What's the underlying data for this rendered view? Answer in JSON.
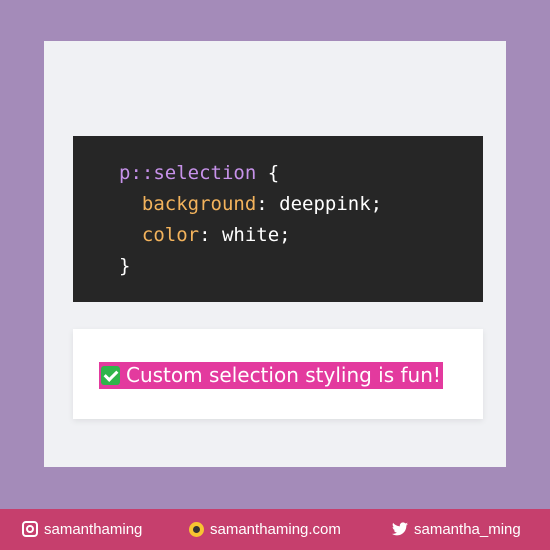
{
  "code": {
    "line1_selector": "p::selection",
    "line1_brace": " {",
    "line2_prop": "background",
    "line2_value": ": deeppink;",
    "line3_prop": "color",
    "line3_value": ": white;",
    "line4_brace": "}"
  },
  "preview": {
    "text": "Custom selection styling is fun!",
    "highlight_color": "#e33a9e",
    "icon": "check-mark-icon"
  },
  "footer": {
    "instagram": "samanthaming",
    "website": "samanthaming.com",
    "twitter": "samantha_ming"
  },
  "colors": {
    "background": "#a48bb9",
    "footer": "#c63f6d",
    "code_background": "#262626"
  }
}
